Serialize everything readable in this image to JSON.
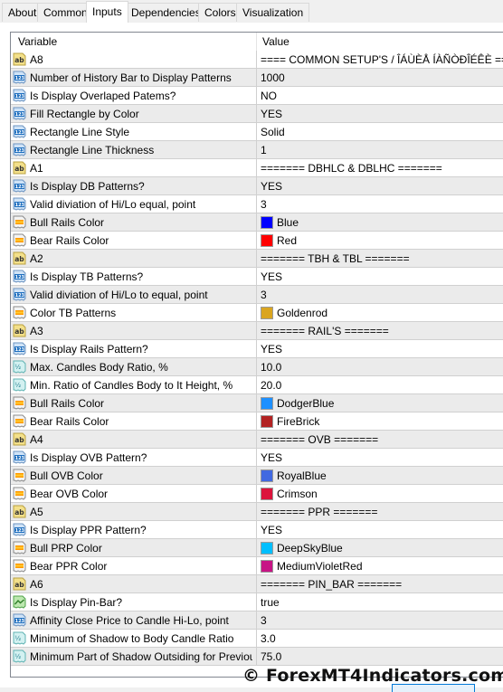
{
  "tabs": [
    {
      "label": "About",
      "active": false
    },
    {
      "label": "Common",
      "active": false
    },
    {
      "label": "Inputs",
      "active": true
    },
    {
      "label": "Dependencies",
      "active": false
    },
    {
      "label": "Colors",
      "active": false
    },
    {
      "label": "Visualization",
      "active": false
    }
  ],
  "table": {
    "headers": {
      "variable": "Variable",
      "value": "Value"
    },
    "rows": [
      {
        "type": "string",
        "icon": "ab-string-icon",
        "name": "A8",
        "value": "==== COMMON SETUP'S / ÎÁÙÈÅ ÍÀÑÒÐÎÉÊÈ ===="
      },
      {
        "type": "int",
        "icon": "int-123-icon",
        "name": "Number of History Bar to Display Patterns",
        "value": "1000"
      },
      {
        "type": "int",
        "icon": "int-123-icon",
        "name": "Is Display Overlaped Patems?",
        "value": "NO"
      },
      {
        "type": "int",
        "icon": "int-123-icon",
        "name": "Fill Rectangle by Color",
        "value": "YES"
      },
      {
        "type": "int",
        "icon": "int-123-icon",
        "name": "Rectangle Line Style",
        "value": "Solid"
      },
      {
        "type": "int",
        "icon": "int-123-icon",
        "name": "Rectangle Line Thickness",
        "value": "1"
      },
      {
        "type": "string",
        "icon": "ab-string-icon",
        "name": "A1",
        "value": "======= DBHLC & DBLHC ======="
      },
      {
        "type": "int",
        "icon": "int-123-icon",
        "name": "Is Display DB Patterns?",
        "value": "YES"
      },
      {
        "type": "int",
        "icon": "int-123-icon",
        "name": "Valid diviation of Hi/Lo equal, point",
        "value": "3"
      },
      {
        "type": "color",
        "icon": "color-icon",
        "name": "Bull Rails Color",
        "value": "Blue",
        "color": "#0000ff"
      },
      {
        "type": "color",
        "icon": "color-icon",
        "name": "Bear Rails Color",
        "value": "Red",
        "color": "#ff0000"
      },
      {
        "type": "string",
        "icon": "ab-string-icon",
        "name": "A2",
        "value": "======= TBH & TBL ======="
      },
      {
        "type": "int",
        "icon": "int-123-icon",
        "name": "Is Display TB Patterns?",
        "value": "YES"
      },
      {
        "type": "int",
        "icon": "int-123-icon",
        "name": "Valid diviation of Hi/Lo to equal, point",
        "value": "3"
      },
      {
        "type": "color",
        "icon": "color-icon",
        "name": "Color TB Patterns",
        "value": "Goldenrod",
        "color": "#daa520"
      },
      {
        "type": "string",
        "icon": "ab-string-icon",
        "name": "A3",
        "value": "======= RAIL'S ======="
      },
      {
        "type": "int",
        "icon": "int-123-icon",
        "name": "Is Display Rails Pattern?",
        "value": "YES"
      },
      {
        "type": "double",
        "icon": "double-half-icon",
        "name": "Max. Candles Body Ratio, %",
        "value": "10.0"
      },
      {
        "type": "double",
        "icon": "double-half-icon",
        "name": "Min. Ratio of Candles Body to It Height, %",
        "value": "20.0"
      },
      {
        "type": "color",
        "icon": "color-icon",
        "name": "Bull Rails Color",
        "value": "DodgerBlue",
        "color": "#1e90ff"
      },
      {
        "type": "color",
        "icon": "color-icon",
        "name": "Bear Rails Color",
        "value": "FireBrick",
        "color": "#b22222"
      },
      {
        "type": "string",
        "icon": "ab-string-icon",
        "name": "A4",
        "value": "======= OVB  ======="
      },
      {
        "type": "int",
        "icon": "int-123-icon",
        "name": "Is Display OVB Pattern?",
        "value": "YES"
      },
      {
        "type": "color",
        "icon": "color-icon",
        "name": "Bull OVB Color",
        "value": "RoyalBlue",
        "color": "#4169e1"
      },
      {
        "type": "color",
        "icon": "color-icon",
        "name": "Bear OVB Color",
        "value": "Crimson",
        "color": "#dc143c"
      },
      {
        "type": "string",
        "icon": "ab-string-icon",
        "name": "A5",
        "value": "======= PPR  ======="
      },
      {
        "type": "int",
        "icon": "int-123-icon",
        "name": "Is Display PPR Pattern?",
        "value": "YES"
      },
      {
        "type": "color",
        "icon": "color-icon",
        "name": "Bull PRP Color",
        "value": "DeepSkyBlue",
        "color": "#00bfff"
      },
      {
        "type": "color",
        "icon": "color-icon",
        "name": "Bear PPR Color",
        "value": "MediumVioletRed",
        "color": "#c71585"
      },
      {
        "type": "string",
        "icon": "ab-string-icon",
        "name": "A6",
        "value": "======= PIN_BAR  ======="
      },
      {
        "type": "bool",
        "icon": "bool-chart-icon",
        "name": "Is Display Pin-Bar?",
        "value": "true"
      },
      {
        "type": "int",
        "icon": "int-123-icon",
        "name": "Affinity Close Price to Candle Hi-Lo, point",
        "value": "3"
      },
      {
        "type": "double",
        "icon": "double-half-icon",
        "name": "Minimum of Shadow to Body Candle Ratio",
        "value": "3.0"
      },
      {
        "type": "double",
        "icon": "double-half-icon",
        "name": "Minimum Part of Shadow Outsiding for Previous B...",
        "value": "75.0"
      }
    ]
  },
  "watermark": "© ForexMT4Indicators.com"
}
